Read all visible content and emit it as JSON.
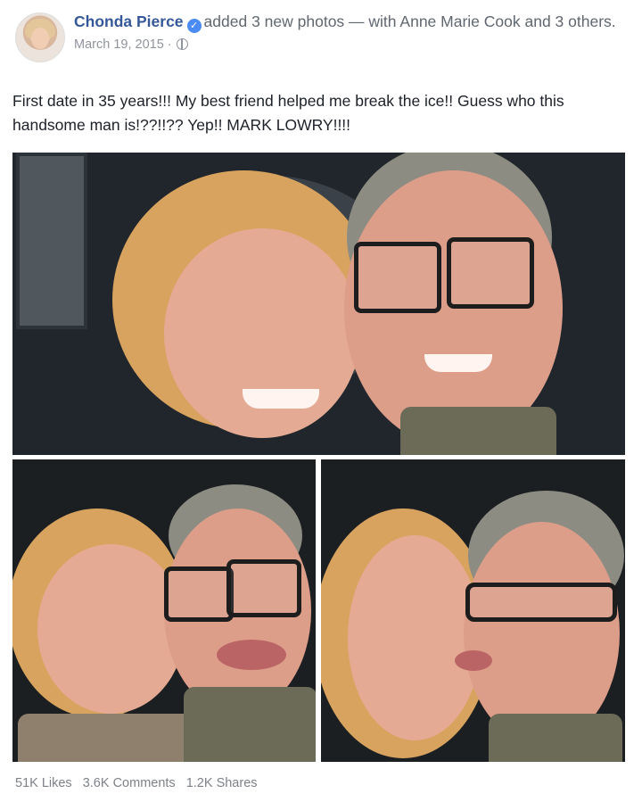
{
  "post": {
    "author": "Chonda Pierce",
    "verified_icon": "verified-badge-icon",
    "action_text": "added 3 new photos — with Anne Marie Cook and 3 others.",
    "date": "March 19, 2015 ·",
    "privacy_icon": "globe-icon",
    "caption": "First date in 35 years!!! My best friend helped me break the ice!! Guess who this handsome man is!??!!?? Yep!! MARK LOWRY!!!!"
  },
  "stats": {
    "likes": "51K Likes",
    "comments": "3.6K Comments",
    "shares": "1.2K Shares"
  },
  "colors": {
    "author_blue": "#365899",
    "muted_gray": "#90949c",
    "verified_blue": "#4b8bf5"
  }
}
